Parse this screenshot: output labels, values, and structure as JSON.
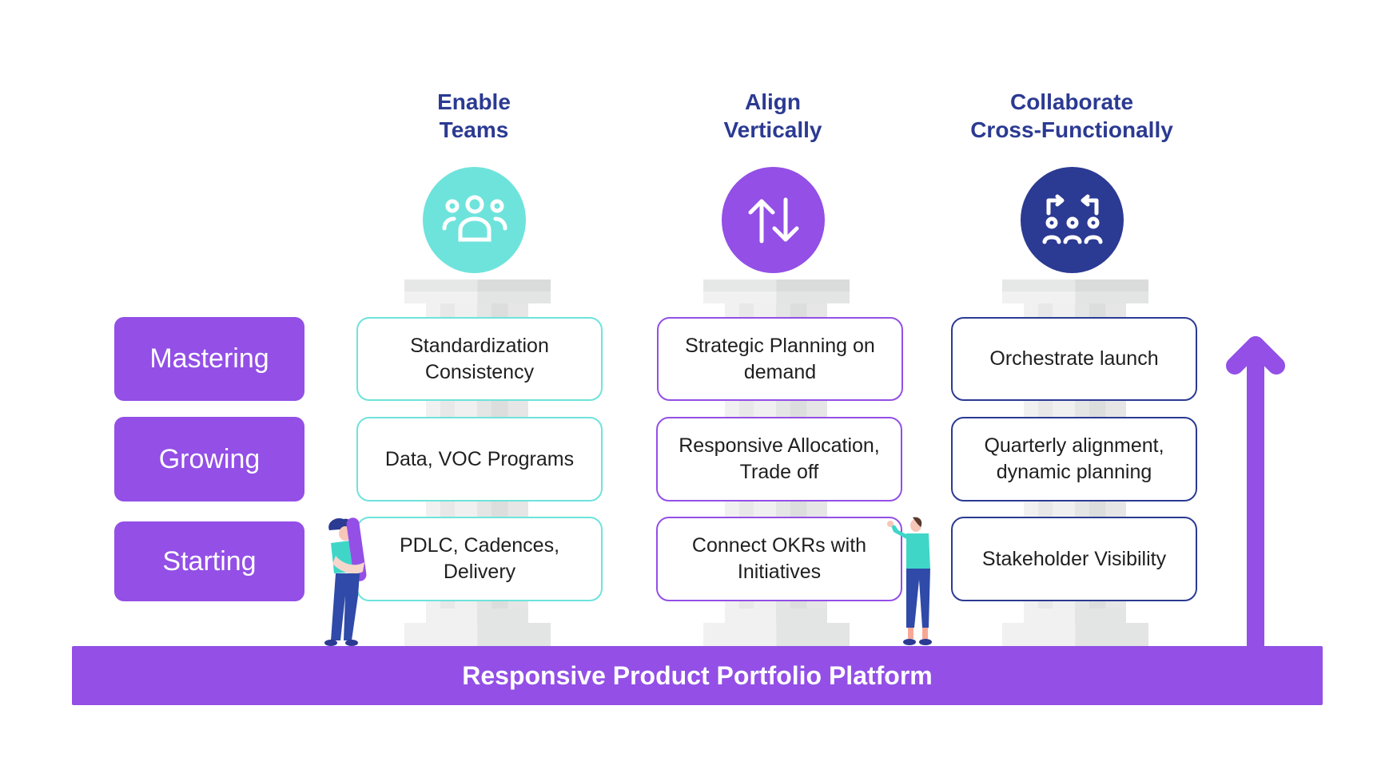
{
  "columns": [
    {
      "heading_line1": "Enable",
      "heading_line2": "Teams",
      "icon": "team-people-icon",
      "color": "#6ee3dc",
      "cells": [
        "Standardization Consistency",
        "Data, VOC Programs",
        "PDLC, Cadences, Delivery"
      ]
    },
    {
      "heading_line1": "Align",
      "heading_line2": "Vertically",
      "icon": "up-down-arrows-icon",
      "color": "#934fe6",
      "cells": [
        "Strategic Planning on demand",
        "Responsive Allocation, Trade off",
        "Connect OKRs with Initiatives"
      ]
    },
    {
      "heading_line1": "Collaborate",
      "heading_line2": "Cross-Functionally",
      "icon": "cross-functional-collaboration-icon",
      "color": "#2b3a92",
      "cells": [
        "Orchestrate launch",
        "Quarterly alignment, dynamic planning",
        "Stakeholder Visibility"
      ]
    }
  ],
  "levels": [
    "Mastering",
    "Growing",
    "Starting"
  ],
  "platform": {
    "label": "Responsive Product Portfolio Platform"
  },
  "progress_arrow": {
    "icon": "up-arrow-icon",
    "color": "#934fe6"
  },
  "colors": {
    "heading": "#2b3a92",
    "accent_purple": "#934fe6",
    "teal": "#6ee3dc",
    "navy": "#2b3a92"
  }
}
